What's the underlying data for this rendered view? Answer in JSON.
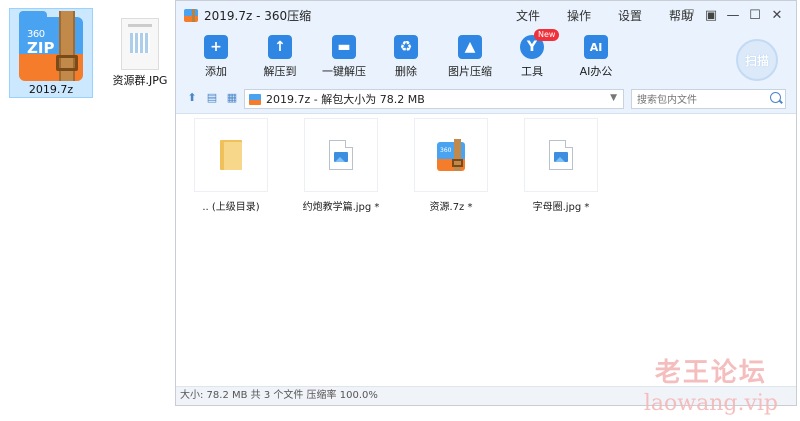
{
  "desktop": {
    "icons": [
      {
        "label": "2019.7z",
        "selected": true
      },
      {
        "label": "资源群.JPG",
        "selected": false
      }
    ],
    "zip_icon_text": {
      "line1": "360",
      "line2": "ZIP"
    }
  },
  "window": {
    "title": "2019.7z - 360压缩",
    "menus": [
      "文件",
      "操作",
      "设置",
      "帮助"
    ],
    "toolbar": [
      {
        "label": "添加",
        "icon": "add-icon",
        "color": "#2f86e3"
      },
      {
        "label": "解压到",
        "icon": "extract-to-icon",
        "color": "#2f86e3"
      },
      {
        "label": "一键解压",
        "icon": "one-click-extract-icon",
        "color": "#2f86e3"
      },
      {
        "label": "删除",
        "icon": "delete-icon",
        "color": "#2f86e3"
      },
      {
        "label": "图片压缩",
        "icon": "image-compress-icon",
        "color": "#2f86e3"
      },
      {
        "label": "工具",
        "icon": "tools-icon",
        "color": "#2f86e3",
        "badge": "New"
      },
      {
        "label": "AI办公",
        "icon": "ai-office-icon",
        "color": "#2f86e3",
        "glyph": "AI"
      }
    ],
    "scan_label": "扫描",
    "address": "2019.7z - 解包大小为 78.2 MB",
    "search_placeholder": "搜索包内文件",
    "files": [
      {
        "label": ".. (上级目录)",
        "type": "folder"
      },
      {
        "label": "约炮教学篇.jpg *",
        "type": "image"
      },
      {
        "label": "资源.7z *",
        "type": "zip"
      },
      {
        "label": "字母圈.jpg *",
        "type": "image"
      }
    ],
    "status": "大小: 78.2 MB 共 3 个文件 压缩率 100.0%"
  },
  "watermark": {
    "cn": "老王论坛",
    "en": "laowang.vip"
  }
}
